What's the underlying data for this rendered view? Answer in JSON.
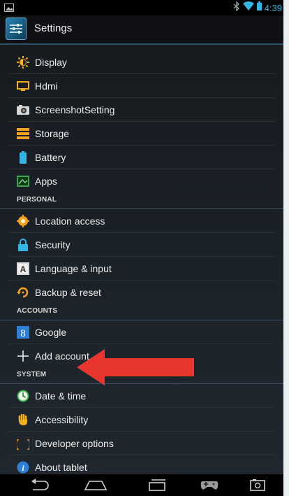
{
  "status_bar": {
    "time": "4:39"
  },
  "action_bar": {
    "title": "Settings"
  },
  "colors": {
    "accent": "#33b5e5",
    "arrow": "#e8362c"
  },
  "list": {
    "top_items": [
      {
        "label": "Display",
        "icon": "display-icon"
      },
      {
        "label": "Hdmi",
        "icon": "hdmi-icon"
      },
      {
        "label": "ScreenshotSetting",
        "icon": "camera-icon"
      },
      {
        "label": "Storage",
        "icon": "storage-icon"
      },
      {
        "label": "Battery",
        "icon": "battery-icon"
      },
      {
        "label": "Apps",
        "icon": "apps-icon"
      }
    ],
    "personal": {
      "header": "PERSONAL",
      "items": [
        {
          "label": "Location access",
          "icon": "location-icon"
        },
        {
          "label": "Security",
          "icon": "lock-icon"
        },
        {
          "label": "Language & input",
          "icon": "language-icon"
        },
        {
          "label": "Backup & reset",
          "icon": "backup-icon"
        }
      ]
    },
    "accounts": {
      "header": "ACCOUNTS",
      "items": [
        {
          "label": "Google",
          "icon": "google-icon"
        },
        {
          "label": "Add account",
          "icon": "plus-icon"
        }
      ]
    },
    "system": {
      "header": "SYSTEM",
      "items": [
        {
          "label": "Date & time",
          "icon": "clock-icon"
        },
        {
          "label": "Accessibility",
          "icon": "hand-icon"
        },
        {
          "label": "Developer options",
          "icon": "braces-icon"
        },
        {
          "label": "About tablet",
          "icon": "info-icon"
        }
      ]
    }
  }
}
